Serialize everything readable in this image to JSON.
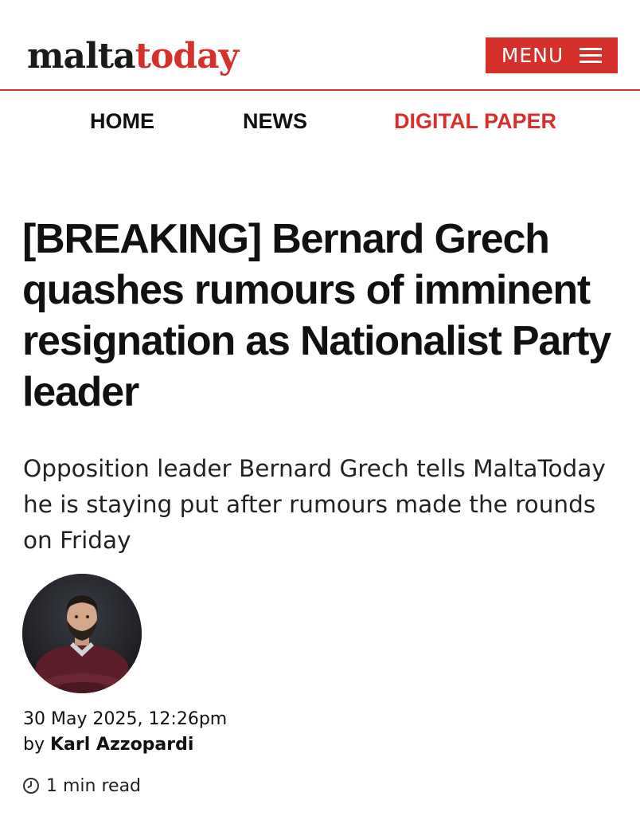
{
  "header": {
    "logo_part1": "malta",
    "logo_part2": "today",
    "menu_label": "MENU",
    "menu_icon": "hamburger-icon",
    "accent_color": "#d6302b"
  },
  "nav": {
    "items": [
      {
        "label": "HOME"
      },
      {
        "label": "NEWS"
      },
      {
        "label": "DIGITAL PAPER"
      }
    ]
  },
  "article": {
    "headline": "[BREAKING] Bernard Grech quashes rumours of imminent resignation as Nationalist Party leader",
    "subtitle": "Opposition leader Bernard Grech tells MaltaToday he is staying put after rumours made the rounds on Friday",
    "date": "30 May 2025, 12:26pm",
    "by_prefix": "by",
    "author": "Karl Azzopardi",
    "read_time": "1 min read",
    "read_time_icon": "clock-icon"
  }
}
